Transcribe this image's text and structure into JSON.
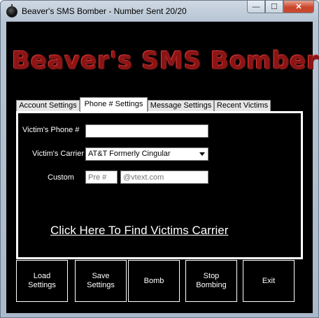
{
  "window": {
    "title": "Beaver's SMS Bomber - Number Sent 20/20",
    "minimize_label": "—",
    "maximize_label": "☐",
    "close_label": "✕"
  },
  "logo_text": "Beaver's SMS Bomber",
  "tabs": [
    {
      "label": "Account Settings",
      "active": false
    },
    {
      "label": "Phone # Settings",
      "active": true
    },
    {
      "label": "Message Settings",
      "active": false
    },
    {
      "label": "Recent Victims",
      "active": false
    }
  ],
  "phone_settings": {
    "phone_label": "Victim's Phone #",
    "phone_value": "",
    "carrier_label": "Victim's Carrier",
    "carrier_value": "AT&T Formerly Cingular",
    "custom_label": "Custom",
    "custom_prefix_placeholder": "Pre #",
    "custom_domain_placeholder": "@vtext.com",
    "find_carrier_link": "Click Here To Find Victims Carrier"
  },
  "buttons": {
    "load": "Load\nSettings",
    "save": "Save\nSettings",
    "bomb": "Bomb",
    "stop": "Stop\nBombing",
    "exit": "Exit"
  },
  "colors": {
    "client_bg": "#000000",
    "logo_red": "#8c1414",
    "text": "#ffffff"
  }
}
